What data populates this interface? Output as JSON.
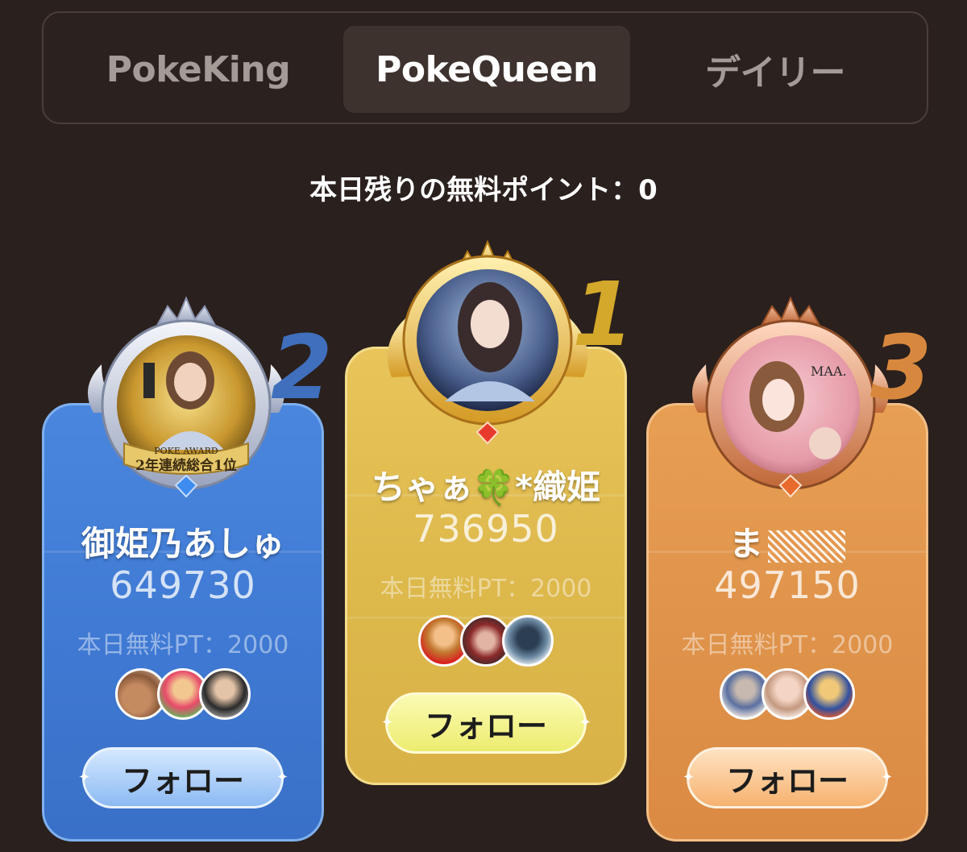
{
  "tabs": [
    {
      "label": "PokeKing",
      "active": false
    },
    {
      "label": "PokeQueen",
      "active": true
    },
    {
      "label": "デイリー",
      "active": false
    }
  ],
  "free_points_text": "本日残りの無料ポイント：0",
  "ranking": [
    {
      "rank": "2",
      "name": "御姫乃あしゅ",
      "score": "649730",
      "free_pt": "本日無料PT：2000",
      "follow_label": "フォロー",
      "badge_text": [
        "POKE AWARD",
        "2年連続総合1位"
      ],
      "color": "#4180d8"
    },
    {
      "rank": "1",
      "name": "ちゃぁ🍀*織姫",
      "score": "736950",
      "free_pt": "本日無料PT：2000",
      "follow_label": "フォロー",
      "color": "#e0bb4e"
    },
    {
      "rank": "3",
      "name": "ま",
      "score": "497150",
      "free_pt": "本日無料PT：2000",
      "follow_label": "フォロー",
      "badge_text": [
        "MAA."
      ],
      "color": "#e0924a"
    }
  ]
}
